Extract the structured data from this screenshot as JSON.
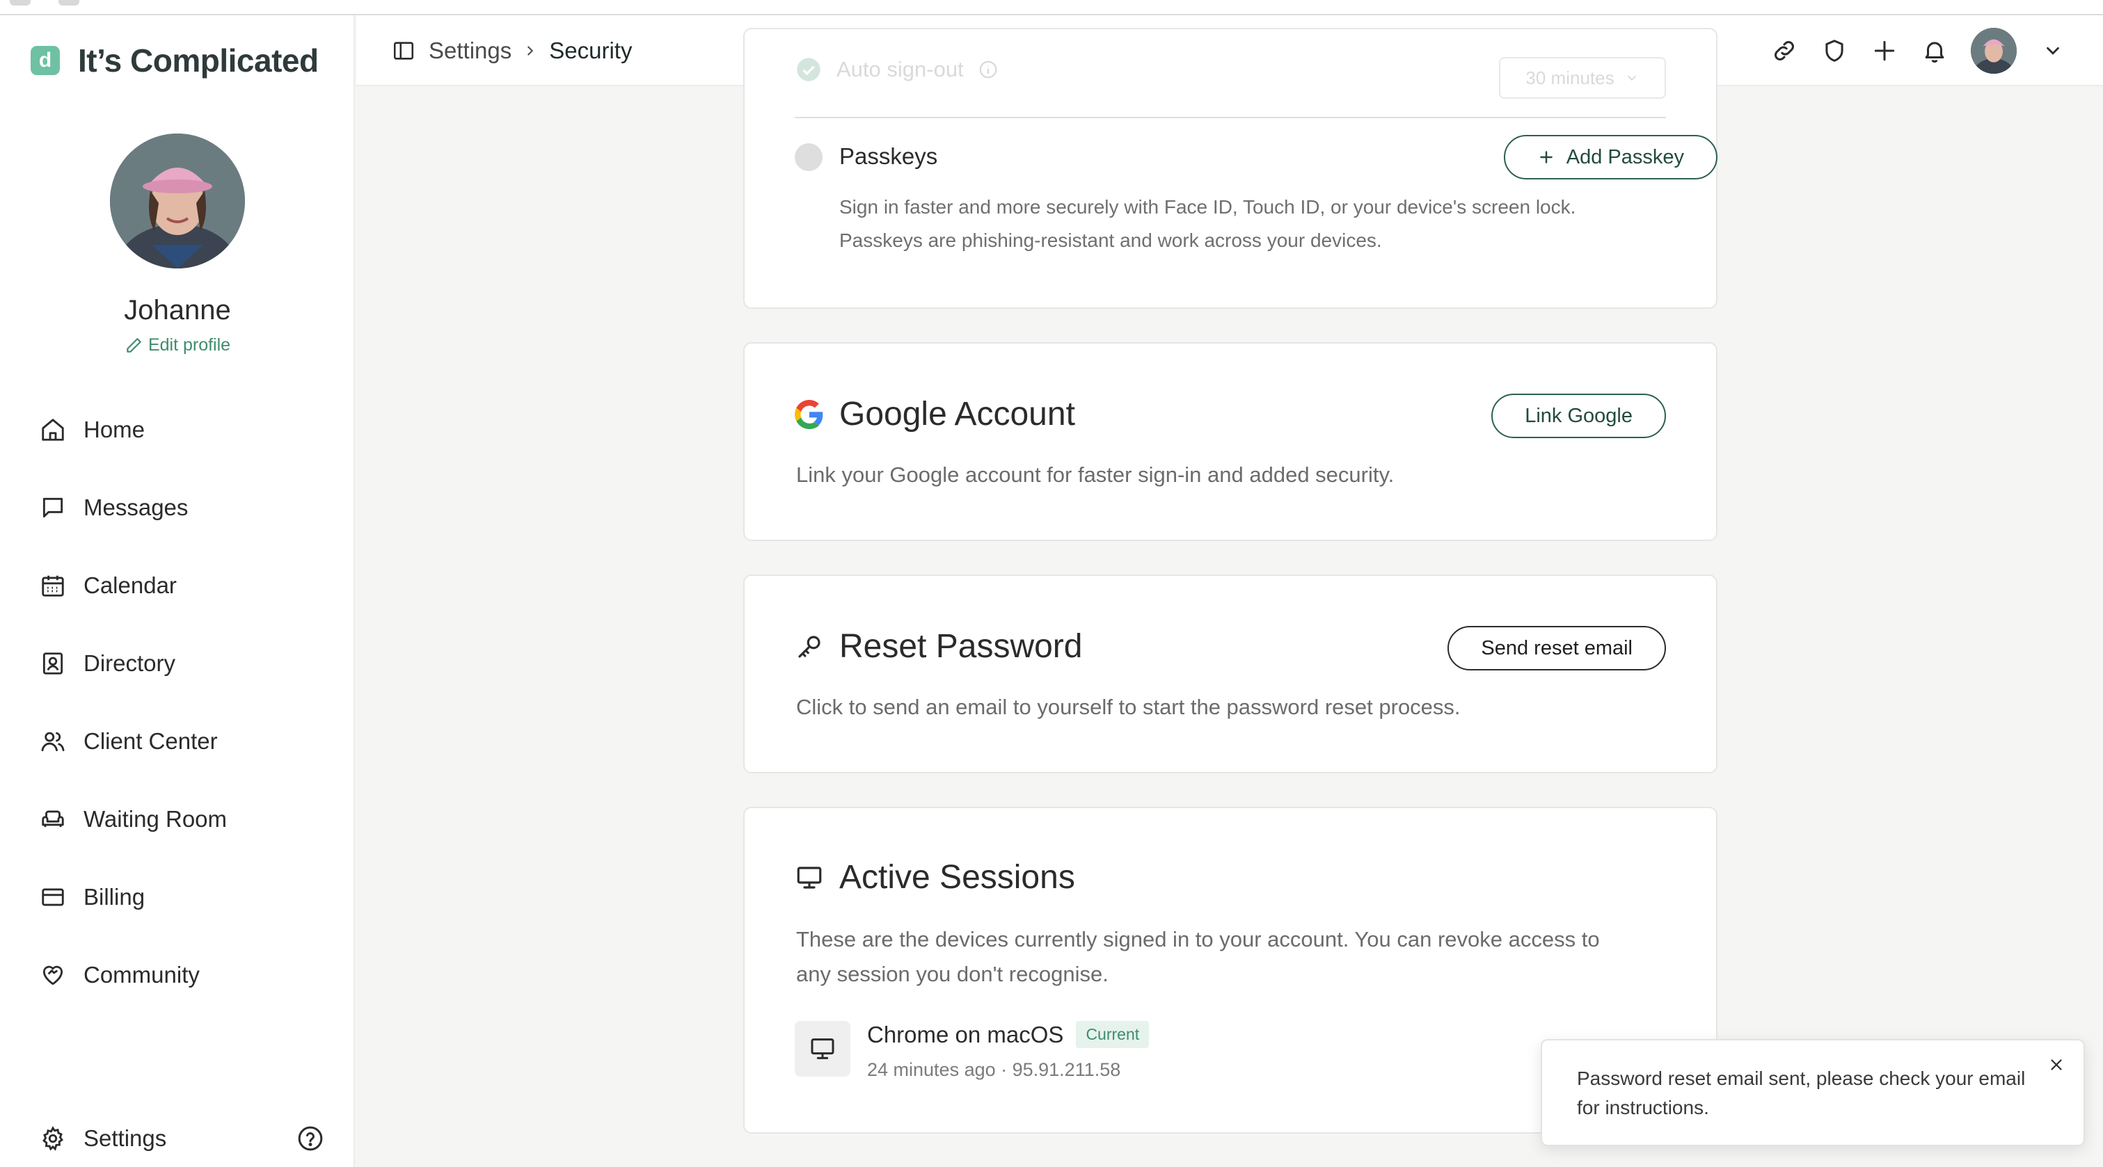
{
  "app": {
    "name": "It’s Complicated",
    "logo_letter": "d",
    "brand_color": "#6fc1a4",
    "accent_color": "#3f8c6e"
  },
  "profile": {
    "name": "Johanne",
    "edit_label": "Edit profile"
  },
  "sidebar": {
    "items": [
      {
        "label": "Home",
        "icon": "home-icon"
      },
      {
        "label": "Messages",
        "icon": "message-icon"
      },
      {
        "label": "Calendar",
        "icon": "calendar-icon"
      },
      {
        "label": "Directory",
        "icon": "contact-card-icon"
      },
      {
        "label": "Client Center",
        "icon": "users-icon"
      },
      {
        "label": "Waiting Room",
        "icon": "armchair-icon"
      },
      {
        "label": "Billing",
        "icon": "credit-card-icon"
      },
      {
        "label": "Community",
        "icon": "heart-handshake-icon"
      }
    ],
    "settings_label": "Settings",
    "help_icon": "help-circle-icon"
  },
  "topbar": {
    "breadcrumb": {
      "parent": "Settings",
      "current": "Security"
    },
    "icons": [
      "link-icon",
      "shield-icon",
      "plus-icon",
      "bell-icon",
      "avatar",
      "chevron-down-icon"
    ]
  },
  "security": {
    "auto_signout": {
      "label": "Auto sign-out",
      "value": "30 minutes"
    },
    "passkeys": {
      "label": "Passkeys",
      "button": "Add Passkey",
      "description_line1": "Sign in faster and more securely with Face ID, Touch ID, or your device's screen lock.",
      "description_line2": "Passkeys are phishing-resistant and work across your devices."
    },
    "google": {
      "title": "Google Account",
      "button": "Link Google",
      "description": "Link your Google account for faster sign-in and added security."
    },
    "reset_password": {
      "title": "Reset Password",
      "button": "Send reset email",
      "description": "Click to send an email to yourself to start the password reset process."
    },
    "sessions": {
      "title": "Active Sessions",
      "description_line1": "These are the devices currently signed in to your account. You can revoke access to",
      "description_line2": "any session you don't recognise.",
      "items": [
        {
          "device": "Chrome on macOS",
          "badge": "Current",
          "meta": "24 minutes ago · 95.91.211.58"
        }
      ]
    }
  },
  "toast": {
    "message": "Password reset email sent, please check your email for instructions."
  }
}
